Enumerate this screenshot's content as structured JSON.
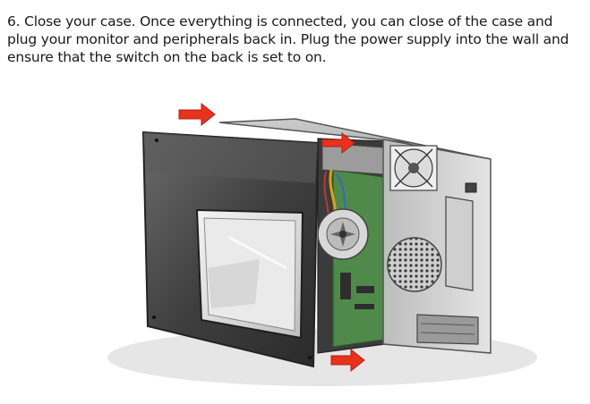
{
  "step": {
    "text": "6. Close your case. Once everything is connected, you can close of the case and plug your monitor and peripherals back in. Plug the power supply into the wall and ensure that the switch on the back is set to on."
  },
  "illustration": {
    "subject": "computer-case",
    "arrow_color": "#e8321e"
  }
}
